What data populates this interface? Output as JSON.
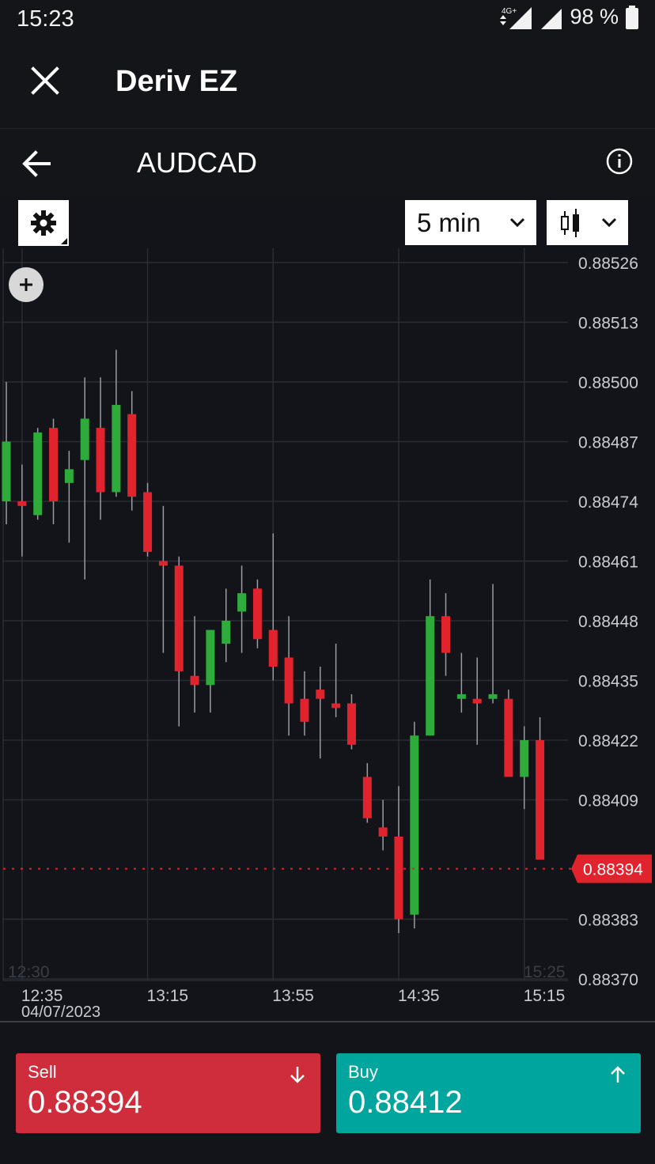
{
  "status_bar": {
    "time": "15:23",
    "network": "4G+",
    "battery": "98 %"
  },
  "app_bar": {
    "title": "Deriv EZ"
  },
  "symbol_bar": {
    "symbol": "AUDCAD"
  },
  "toolbar": {
    "timeframe": "5 min"
  },
  "colors": {
    "bull": "#2eab3a",
    "bear": "#e0232c",
    "sell": "#cf2d3b",
    "buy": "#00a59d",
    "background": "#131419"
  },
  "chart_data": {
    "type": "candlestick",
    "y_ticks": [
      "0.88526",
      "0.88513",
      "0.88500",
      "0.88487",
      "0.88474",
      "0.88461",
      "0.88448",
      "0.88435",
      "0.88422",
      "0.88409",
      "0.88383",
      "0.88370"
    ],
    "y_range": [
      0.8837,
      0.8853
    ],
    "x_ticks": [
      "12:35",
      "13:15",
      "13:55",
      "14:35",
      "15:15"
    ],
    "x_tick_times": [
      "12:35",
      "13:15",
      "13:55",
      "14:35",
      "15:15"
    ],
    "date_label": "04/07/2023",
    "faded_start_label": "12:30",
    "faded_end_label": "15:25",
    "current_price": "0.88394",
    "current_price_value": 0.88394,
    "candles": [
      {
        "time": "12:30",
        "open": 0.88474,
        "high": 0.885,
        "low": 0.88469,
        "close": 0.88487
      },
      {
        "time": "12:35",
        "open": 0.88474,
        "high": 0.88482,
        "low": 0.88462,
        "close": 0.88473
      },
      {
        "time": "12:40",
        "open": 0.88471,
        "high": 0.8849,
        "low": 0.8847,
        "close": 0.88489
      },
      {
        "time": "12:45",
        "open": 0.8849,
        "high": 0.88492,
        "low": 0.88469,
        "close": 0.88474
      },
      {
        "time": "12:50",
        "open": 0.88478,
        "high": 0.88485,
        "low": 0.88465,
        "close": 0.88481
      },
      {
        "time": "12:55",
        "open": 0.88483,
        "high": 0.88501,
        "low": 0.88457,
        "close": 0.88492
      },
      {
        "time": "13:00",
        "open": 0.8849,
        "high": 0.88501,
        "low": 0.8847,
        "close": 0.88476
      },
      {
        "time": "13:05",
        "open": 0.88476,
        "high": 0.88507,
        "low": 0.88475,
        "close": 0.88495
      },
      {
        "time": "13:10",
        "open": 0.88493,
        "high": 0.88498,
        "low": 0.88472,
        "close": 0.88475
      },
      {
        "time": "13:15",
        "open": 0.88476,
        "high": 0.88478,
        "low": 0.88462,
        "close": 0.88463
      },
      {
        "time": "13:20",
        "open": 0.88461,
        "high": 0.88473,
        "low": 0.88441,
        "close": 0.8846
      },
      {
        "time": "13:25",
        "open": 0.8846,
        "high": 0.88462,
        "low": 0.88425,
        "close": 0.88437
      },
      {
        "time": "13:30",
        "open": 0.88436,
        "high": 0.88449,
        "low": 0.88428,
        "close": 0.88434
      },
      {
        "time": "13:35",
        "open": 0.88434,
        "high": 0.88436,
        "low": 0.88428,
        "close": 0.88446
      },
      {
        "time": "13:40",
        "open": 0.88443,
        "high": 0.88455,
        "low": 0.88439,
        "close": 0.88448
      },
      {
        "time": "13:45",
        "open": 0.8845,
        "high": 0.8846,
        "low": 0.88441,
        "close": 0.88454
      },
      {
        "time": "13:50",
        "open": 0.88455,
        "high": 0.88457,
        "low": 0.88442,
        "close": 0.88444
      },
      {
        "time": "13:55",
        "open": 0.88446,
        "high": 0.88467,
        "low": 0.88435,
        "close": 0.88438
      },
      {
        "time": "14:00",
        "open": 0.8844,
        "high": 0.88449,
        "low": 0.88423,
        "close": 0.8843
      },
      {
        "time": "14:05",
        "open": 0.88431,
        "high": 0.88437,
        "low": 0.88423,
        "close": 0.88426
      },
      {
        "time": "14:10",
        "open": 0.88433,
        "high": 0.88438,
        "low": 0.88418,
        "close": 0.88431
      },
      {
        "time": "14:15",
        "open": 0.8843,
        "high": 0.88443,
        "low": 0.88427,
        "close": 0.88429
      },
      {
        "time": "14:20",
        "open": 0.8843,
        "high": 0.88432,
        "low": 0.8842,
        "close": 0.88421
      },
      {
        "time": "14:25",
        "open": 0.88414,
        "high": 0.88417,
        "low": 0.88404,
        "close": 0.88405
      },
      {
        "time": "14:30",
        "open": 0.88403,
        "high": 0.88409,
        "low": 0.88398,
        "close": 0.88401
      },
      {
        "time": "14:35",
        "open": 0.88401,
        "high": 0.88412,
        "low": 0.8838,
        "close": 0.88383
      },
      {
        "time": "14:40",
        "open": 0.88384,
        "high": 0.88426,
        "low": 0.88381,
        "close": 0.88423
      },
      {
        "time": "14:45",
        "open": 0.88423,
        "high": 0.88457,
        "low": 0.88423,
        "close": 0.88449
      },
      {
        "time": "14:50",
        "open": 0.88449,
        "high": 0.88454,
        "low": 0.88436,
        "close": 0.88441
      },
      {
        "time": "14:55",
        "open": 0.88431,
        "high": 0.88441,
        "low": 0.88428,
        "close": 0.88432
      },
      {
        "time": "15:00",
        "open": 0.88431,
        "high": 0.8844,
        "low": 0.88421,
        "close": 0.8843
      },
      {
        "time": "15:05",
        "open": 0.88431,
        "high": 0.88456,
        "low": 0.8843,
        "close": 0.88432
      },
      {
        "time": "15:10",
        "open": 0.88431,
        "high": 0.88433,
        "low": 0.88414,
        "close": 0.88414
      },
      {
        "time": "15:15",
        "open": 0.88414,
        "high": 0.88425,
        "low": 0.88407,
        "close": 0.88422
      },
      {
        "time": "15:20",
        "open": 0.88422,
        "high": 0.88427,
        "low": 0.88396,
        "close": 0.88396
      }
    ]
  },
  "sell": {
    "label": "Sell",
    "price": "0.88394"
  },
  "buy": {
    "label": "Buy",
    "price": "0.88412"
  }
}
